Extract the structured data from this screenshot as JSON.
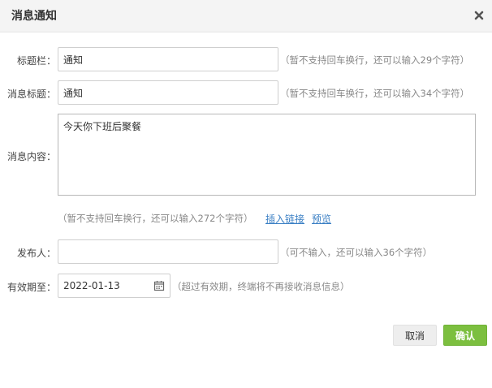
{
  "dialog": {
    "title": "消息通知",
    "close_icon": "close-icon"
  },
  "form": {
    "title_bar": {
      "label": "标题栏：",
      "value": "通知",
      "hint": "（暂不支持回车换行，还可以输入29个字符）"
    },
    "message_title": {
      "label": "消息标题：",
      "value": "通知",
      "hint": "（暂不支持回车换行，还可以输入34个字符）"
    },
    "message_content": {
      "label": "消息内容：",
      "value": "今天你下班后聚餐",
      "hint": "（暂不支持回车换行，还可以输入272个字符）",
      "insert_link": "插入链接",
      "preview": "预览"
    },
    "publisher": {
      "label": "发布人：",
      "value": "",
      "hint": "（可不输入，还可以输入36个字符）"
    },
    "expiry": {
      "label": "有效期至：",
      "value": "2022-01-13",
      "hint": "（超过有效期，终端将不再接收消息信息）",
      "icon": "calendar-icon"
    }
  },
  "footer": {
    "cancel_label": "取消",
    "confirm_label": "确认"
  },
  "colors": {
    "confirm": "#7cbf3f",
    "link": "#3a7fc4",
    "header_bg": "#f4f4f4"
  }
}
